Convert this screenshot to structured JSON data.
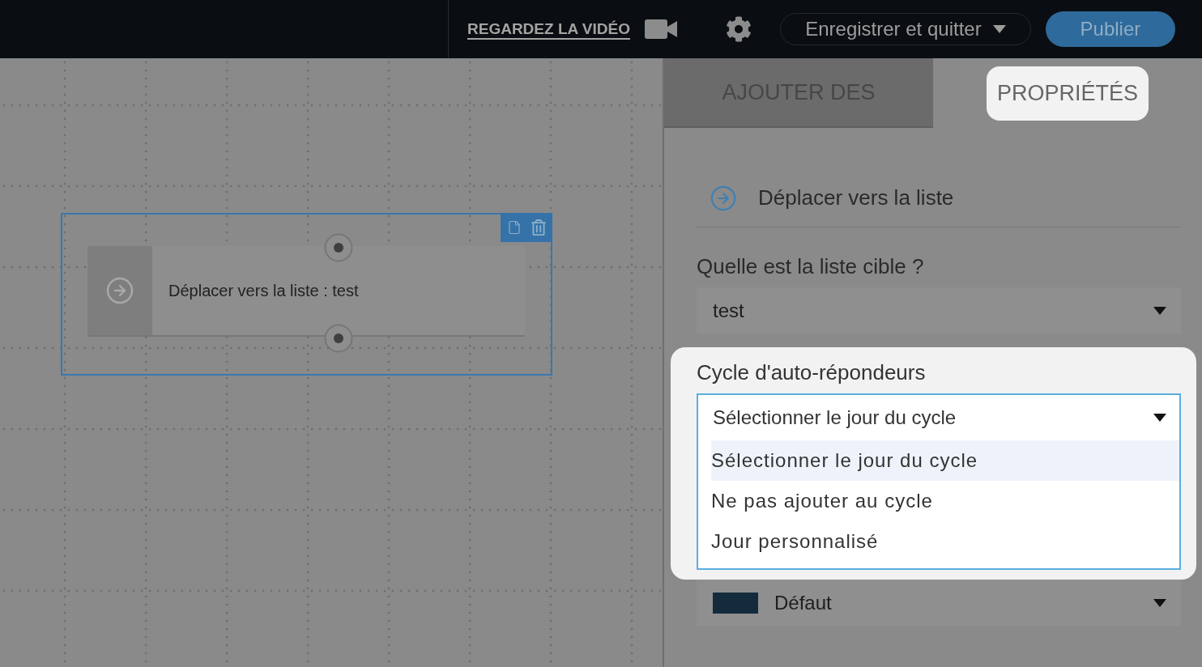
{
  "top_bar": {
    "video_link": "REGARDEZ LA VIDÉO",
    "save_menu": "Enregistrer et quitter",
    "publish": "Publier"
  },
  "canvas": {
    "node": {
      "title": "Déplacer vers la liste : test",
      "selected": true
    }
  },
  "tabs": [
    {
      "label": "AJOUTER DES",
      "selected": false,
      "highlighted": false
    },
    {
      "label": "PROPRIÉTÉS",
      "selected": true,
      "highlighted": true
    }
  ],
  "properties": {
    "action": "Déplacer vers la liste",
    "fields": [
      {
        "kind": "select",
        "label": "Quelle est la liste cible ?",
        "value": "test",
        "expanded": false,
        "highlighted": false
      },
      {
        "kind": "select",
        "label": "Cycle d'auto-répondeurs",
        "value": "Sélectionner le jour du cycle",
        "expanded": true,
        "highlighted": true,
        "options": [
          {
            "label": "Sélectionner le jour du cycle",
            "selected": true
          },
          {
            "label": "Ne pas ajouter au cycle",
            "selected": false
          },
          {
            "label": "Jour personnalisé",
            "selected": false
          }
        ]
      },
      {
        "kind": "color-select",
        "value": "Défaut",
        "color": "#142b3c",
        "expanded": false,
        "highlighted": false
      }
    ]
  }
}
